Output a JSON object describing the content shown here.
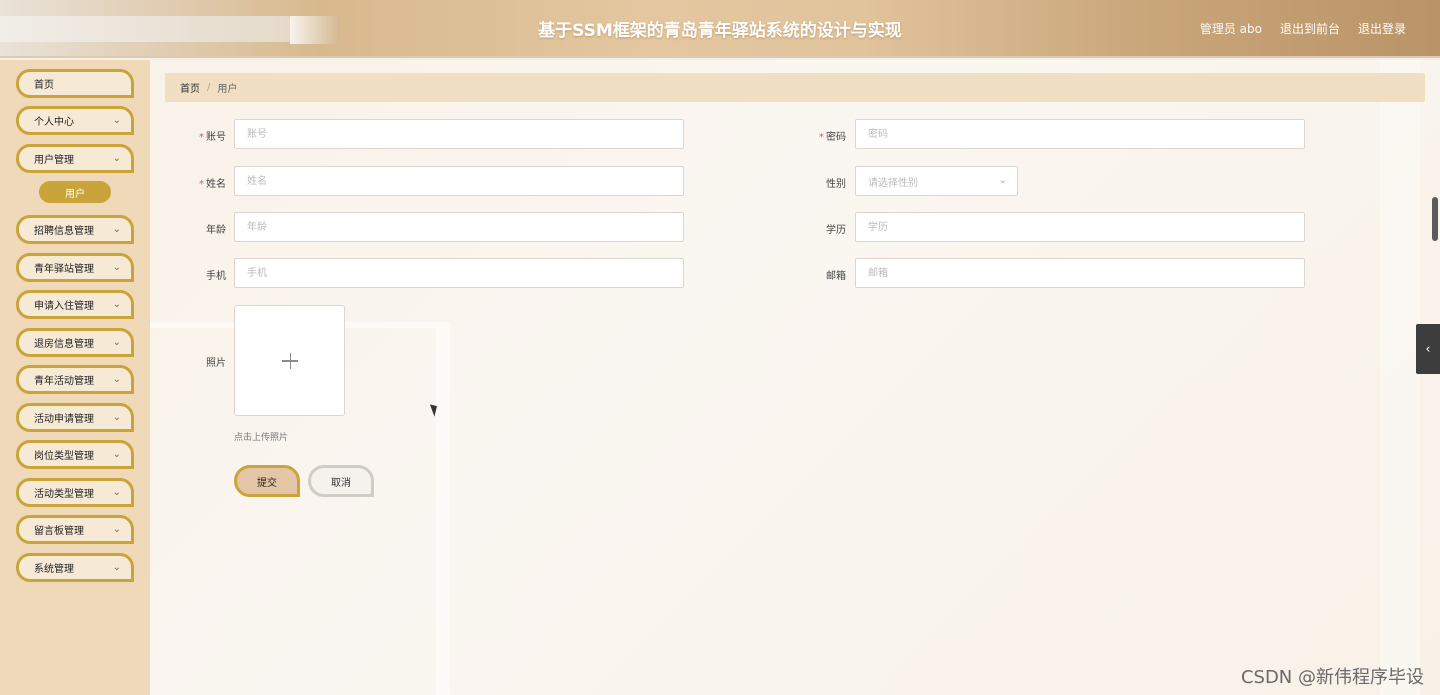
{
  "header": {
    "title": "基于SSM框架的青岛青年驿站系统的设计与实现",
    "admin_label": "管理员 abo",
    "front_link": "退出到前台",
    "logout_link": "退出登录"
  },
  "sidebar": {
    "items": [
      {
        "label": "首页",
        "has_chevron": false
      },
      {
        "label": "个人中心",
        "has_chevron": true
      },
      {
        "label": "用户管理",
        "has_chevron": true
      },
      {
        "label": "招聘信息管理",
        "has_chevron": true
      },
      {
        "label": "青年驿站管理",
        "has_chevron": true
      },
      {
        "label": "申请入住管理",
        "has_chevron": true
      },
      {
        "label": "退房信息管理",
        "has_chevron": true
      },
      {
        "label": "青年活动管理",
        "has_chevron": true
      },
      {
        "label": "活动申请管理",
        "has_chevron": true
      },
      {
        "label": "岗位类型管理",
        "has_chevron": true
      },
      {
        "label": "活动类型管理",
        "has_chevron": true
      },
      {
        "label": "留言板管理",
        "has_chevron": true
      },
      {
        "label": "系统管理",
        "has_chevron": true
      }
    ],
    "active_sub_item": "用户"
  },
  "breadcrumb": {
    "home": "首页",
    "separator": "/",
    "current": "用户"
  },
  "form": {
    "account": {
      "label": "账号",
      "placeholder": "账号",
      "required": "*"
    },
    "password": {
      "label": "密码",
      "placeholder": "密码",
      "required": "*"
    },
    "name": {
      "label": "姓名",
      "placeholder": "姓名",
      "required": "*"
    },
    "gender": {
      "label": "性别",
      "placeholder": "请选择性别"
    },
    "age": {
      "label": "年龄",
      "placeholder": "年龄"
    },
    "education": {
      "label": "学历",
      "placeholder": "学历"
    },
    "phone": {
      "label": "手机",
      "placeholder": "手机"
    },
    "email": {
      "label": "邮箱",
      "placeholder": "邮箱"
    },
    "photo": {
      "label": "照片",
      "tip": "点击上传照片"
    },
    "submit_label": "提交",
    "cancel_label": "取消"
  },
  "side_toggle_icon": "chevron-left-icon",
  "watermark": "CSDN @新伟程序毕设",
  "colors": {
    "accent": "#c9a43a",
    "sidebar_bg": "#efd9b8",
    "breadcrumb_bg": "#f1dfc4",
    "required": "#e2554a"
  }
}
